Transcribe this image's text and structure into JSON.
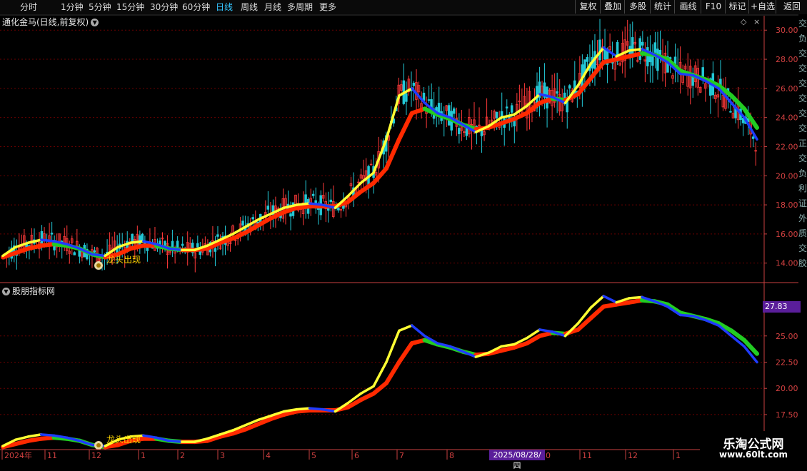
{
  "toolbar": {
    "periods": [
      {
        "label": "分时",
        "active": false
      },
      {
        "label": "1分钟",
        "active": false
      },
      {
        "label": "5分钟",
        "active": false
      },
      {
        "label": "15分钟",
        "active": false
      },
      {
        "label": "30分钟",
        "active": false
      },
      {
        "label": "60分钟",
        "active": false
      },
      {
        "label": "日线",
        "active": true
      },
      {
        "label": "周线",
        "active": false
      },
      {
        "label": "月线",
        "active": false
      },
      {
        "label": "多周期",
        "active": false
      },
      {
        "label": "更多",
        "active": false
      }
    ],
    "more_icon": "chevron-right-icon",
    "right_buttons": [
      "复权",
      "叠加",
      "多股",
      "统计",
      "画线",
      "F10",
      "标记",
      "+自选",
      "返回"
    ]
  },
  "main_chart": {
    "title": "通化金马(日线,前复权)",
    "y_ticks": [
      "30.00",
      "28.00",
      "26.00",
      "24.00",
      "22.00",
      "20.00",
      "18.00",
      "16.00",
      "14.00"
    ],
    "annotation": "龙头出现"
  },
  "sub_chart": {
    "title": "股朋指标网",
    "y_ticks": [
      "25.00",
      "22.50",
      "20.00",
      "17.50"
    ],
    "last_value": "27.83",
    "annotation": "龙头出现"
  },
  "x_axis": {
    "labels": [
      "2024年",
      "11",
      "12",
      "1",
      "2",
      "3",
      "4",
      "5",
      "6",
      "7",
      "8",
      "9",
      "10",
      "11",
      "12",
      "1"
    ],
    "cursor_date": "2025/08/28/四"
  },
  "right_strip": [
    "交",
    "负",
    "交",
    "交",
    "交",
    "交",
    "交",
    "交",
    "正",
    "交",
    "负",
    "利",
    "证",
    "外",
    "质",
    "交",
    "胶"
  ],
  "watermark": {
    "line1": "乐淘公式网",
    "line2": "www.60lt.com"
  },
  "colors": {
    "up": "#ff3a3a",
    "down": "#23c8d6",
    "yellow": "#ffff33",
    "red": "#ff2a00",
    "green": "#22cc22",
    "blue": "#1f3cff",
    "grid": "#6a0000",
    "axis": "#c84040",
    "tick": "#d04040"
  },
  "chart_data": [
    {
      "type": "line",
      "title": "通化金马(日线,前复权)",
      "ylim": [
        13.2,
        30.6
      ],
      "x_labels": [
        "2024年",
        "11",
        "12",
        "1",
        "2",
        "3",
        "4",
        "5",
        "6",
        "7",
        "8",
        "9",
        "10",
        "11",
        "12",
        "1"
      ],
      "series": [
        {
          "values": [
            14.5,
            15.1,
            15.4,
            15.6,
            15.5,
            15.3,
            15.0,
            14.6,
            14.5,
            15.1,
            15.4,
            15.5,
            15.3,
            15.0,
            14.9,
            14.9,
            15.2,
            15.6,
            16.0,
            16.5,
            17.0,
            17.4,
            17.8,
            18.0,
            18.1,
            18.0,
            17.8,
            18.6,
            19.5,
            20.2,
            22.5,
            25.5,
            26.0,
            25.0,
            24.3,
            24.0,
            23.5,
            23.0,
            23.4,
            24.0,
            24.2,
            24.8,
            25.6,
            25.4,
            25.0,
            26.2,
            27.7,
            28.8,
            28.2,
            28.6,
            28.7,
            28.3,
            27.8,
            27.0,
            26.9,
            26.5,
            26.0,
            25.0,
            24.0,
            22.5
          ]
        },
        {
          "values": [
            14.4,
            14.7,
            15.0,
            15.2,
            15.3,
            15.2,
            15.0,
            14.6,
            14.4,
            14.6,
            15.0,
            15.2,
            15.2,
            15.0,
            14.9,
            14.9,
            15.0,
            15.4,
            15.7,
            16.1,
            16.6,
            17.1,
            17.5,
            17.8,
            17.9,
            17.9,
            17.9,
            18.2,
            18.9,
            19.5,
            20.5,
            22.5,
            24.3,
            24.6,
            24.2,
            23.9,
            23.5,
            23.2,
            23.3,
            23.6,
            23.9,
            24.3,
            25.0,
            25.3,
            25.2,
            25.6,
            26.7,
            27.8,
            28.0,
            28.2,
            28.4,
            28.3,
            28.0,
            27.2,
            26.9,
            26.6,
            26.2,
            25.5,
            24.6,
            23.3
          ]
        }
      ]
    },
    {
      "type": "line",
      "title": "股朋指标网",
      "ylim": [
        14.5,
        29.0
      ],
      "x_labels": [
        "2024年",
        "11",
        "12",
        "1",
        "2",
        "3",
        "4",
        "5",
        "6",
        "7",
        "8",
        "9",
        "10",
        "11",
        "12",
        "1"
      ],
      "series": [
        {
          "values": [
            14.5,
            15.1,
            15.4,
            15.6,
            15.5,
            15.3,
            15.0,
            14.6,
            14.5,
            15.1,
            15.4,
            15.5,
            15.3,
            15.0,
            14.9,
            14.9,
            15.2,
            15.6,
            16.0,
            16.5,
            17.0,
            17.4,
            17.8,
            18.0,
            18.1,
            18.0,
            17.8,
            18.6,
            19.5,
            20.2,
            22.5,
            25.5,
            26.0,
            25.0,
            24.3,
            24.0,
            23.5,
            23.0,
            23.4,
            24.0,
            24.2,
            24.8,
            25.6,
            25.4,
            25.0,
            26.2,
            27.7,
            28.8,
            28.2,
            28.6,
            28.7,
            28.3,
            27.8,
            27.0,
            26.9,
            26.5,
            26.0,
            25.0,
            24.0,
            22.5
          ]
        },
        {
          "values": [
            14.4,
            14.7,
            15.0,
            15.2,
            15.3,
            15.2,
            15.0,
            14.6,
            14.4,
            14.6,
            15.0,
            15.2,
            15.2,
            15.0,
            14.9,
            14.9,
            15.0,
            15.4,
            15.7,
            16.1,
            16.6,
            17.1,
            17.5,
            17.8,
            17.9,
            17.9,
            17.9,
            18.2,
            18.9,
            19.5,
            20.5,
            22.5,
            24.3,
            24.6,
            24.2,
            23.9,
            23.5,
            23.2,
            23.3,
            23.6,
            23.9,
            24.3,
            25.0,
            25.3,
            25.2,
            25.6,
            26.7,
            27.8,
            28.0,
            28.2,
            28.4,
            28.3,
            28.0,
            27.2,
            26.9,
            26.6,
            26.2,
            25.5,
            24.6,
            23.3
          ]
        }
      ]
    }
  ]
}
